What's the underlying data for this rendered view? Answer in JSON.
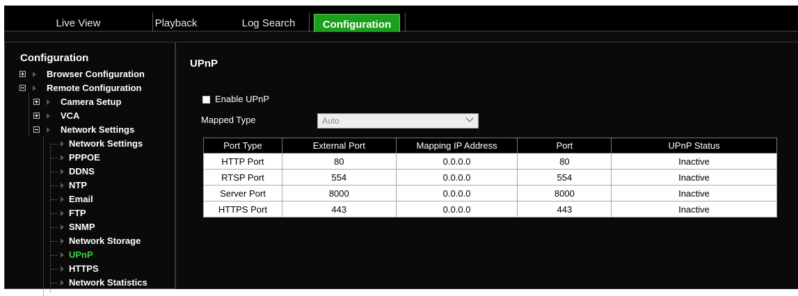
{
  "nav": {
    "tabs": [
      "Live View",
      "Playback",
      "Log Search",
      "Configuration"
    ],
    "active": "Configuration"
  },
  "sidebar": {
    "title": "Configuration",
    "items": [
      {
        "label": "Browser Configuration",
        "expander": "plus"
      },
      {
        "label": "Remote Configuration",
        "expander": "minus"
      },
      {
        "label": "Camera Setup",
        "expander": "plus"
      },
      {
        "label": "VCA",
        "expander": "plus"
      },
      {
        "label": "Network Settings",
        "expander": "minus"
      },
      {
        "label": "Network Settings"
      },
      {
        "label": "PPPOE"
      },
      {
        "label": "DDNS"
      },
      {
        "label": "NTP"
      },
      {
        "label": "Email"
      },
      {
        "label": "FTP"
      },
      {
        "label": "SNMP"
      },
      {
        "label": "Network Storage"
      },
      {
        "label": "UPnP",
        "active": true
      },
      {
        "label": "HTTPS"
      },
      {
        "label": "Network Statistics"
      }
    ]
  },
  "upnp": {
    "title": "UPnP",
    "enable_label": "Enable UPnP",
    "enable_checked": false,
    "mapped_type_label": "Mapped Type",
    "mapped_type_value": "Auto",
    "table": {
      "headers": [
        "Port Type",
        "External Port",
        "Mapping IP Address",
        "Port",
        "UPnP Status"
      ],
      "rows": [
        [
          "HTTP Port",
          "80",
          "0.0.0.0",
          "80",
          "Inactive"
        ],
        [
          "RTSP Port",
          "554",
          "0.0.0.0",
          "554",
          "Inactive"
        ],
        [
          "Server Port",
          "8000",
          "0.0.0.0",
          "8000",
          "Inactive"
        ],
        [
          "HTTPS Port",
          "443",
          "0.0.0.0",
          "443",
          "Inactive"
        ]
      ]
    }
  },
  "colors": {
    "accent": "#1aa01a",
    "active_text": "#39d439",
    "background": "#0a0a0a"
  }
}
